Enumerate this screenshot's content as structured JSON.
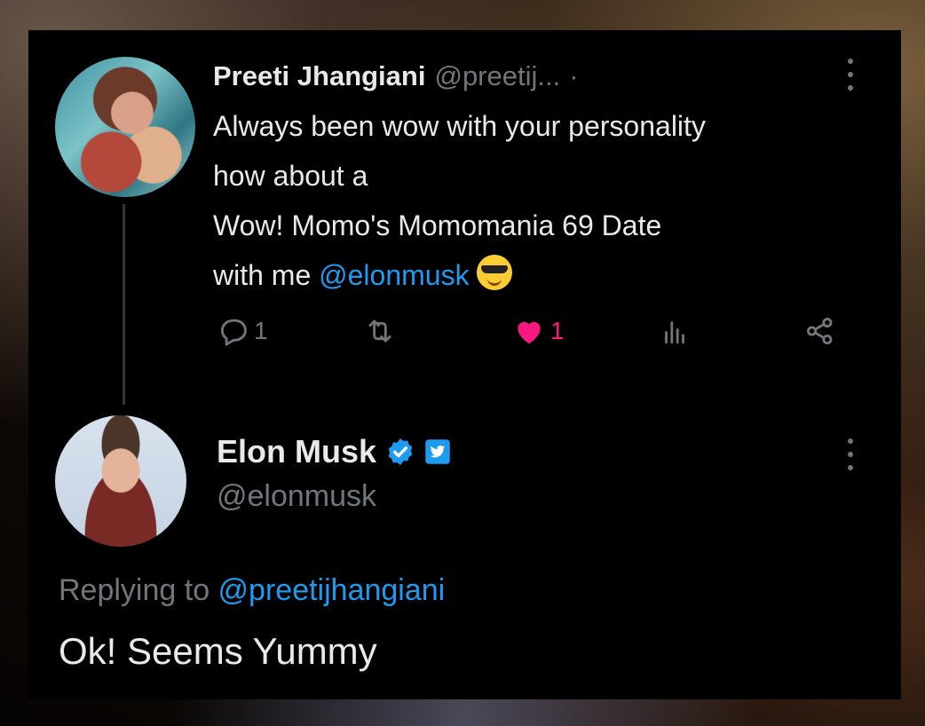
{
  "tweet": {
    "author_name": "Preeti Jhangiani",
    "author_handle": "@preetij...",
    "separator": "·",
    "lines": [
      "Always been wow with your personality",
      "how about a",
      "Wow! Momo's Momomania 69 Date"
    ],
    "last_line_prefix": "with me ",
    "mention": "@elonmusk",
    "emoji": "smiling-face-with-sunglasses",
    "replies_count": "1",
    "likes_count": "1"
  },
  "reply": {
    "author_name": "Elon Musk",
    "author_handle": "@elonmusk",
    "replying_prefix": "Replying to ",
    "replying_handle": "@preetijhangiani",
    "text": "Ok! Seems Yummy"
  },
  "colors": {
    "background": "#000000",
    "text": "#e7e9ea",
    "muted": "#71767b",
    "link": "#1d9bf0",
    "like": "#f91880",
    "verified": "#1d9bf0"
  }
}
